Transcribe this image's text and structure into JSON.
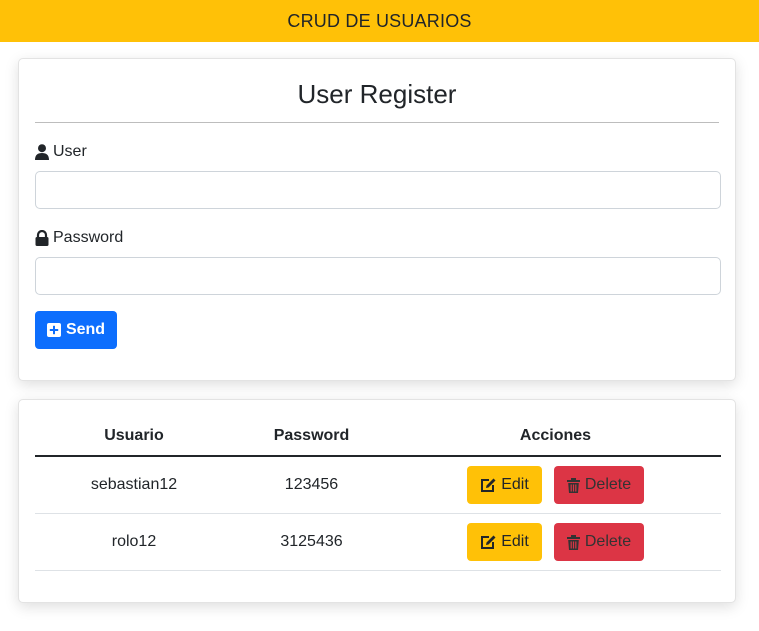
{
  "header": {
    "title": "CRUD DE USUARIOS"
  },
  "form": {
    "title": "User Register",
    "user_label": "User",
    "user_value": "",
    "password_label": "Password",
    "password_value": "",
    "send_label": "Send"
  },
  "table": {
    "headers": [
      "Usuario",
      "Password",
      "Acciones"
    ],
    "rows": [
      {
        "usuario": "sebastian12",
        "password": "123456",
        "edit_label": "Edit",
        "delete_label": "Delete"
      },
      {
        "usuario": "rolo12",
        "password": "3125436",
        "edit_label": "Edit",
        "delete_label": "Delete"
      }
    ]
  },
  "colors": {
    "header_bg": "#ffc107",
    "primary": "#0d6efd",
    "warning": "#ffc107",
    "danger": "#dc3545"
  },
  "icons": {
    "user": "user-icon",
    "password": "lock-icon",
    "send": "plus-square-icon",
    "edit": "edit-icon",
    "delete": "trash-icon"
  }
}
